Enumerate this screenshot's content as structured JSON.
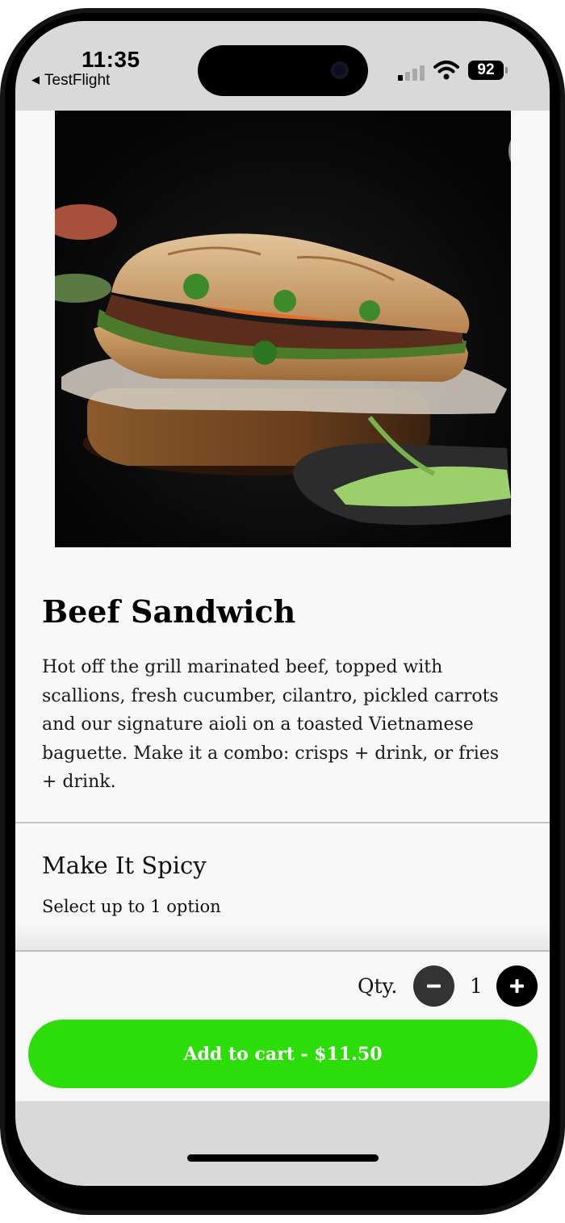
{
  "status_bar": {
    "time": "11:35",
    "back_app": "TestFlight",
    "battery": "92"
  },
  "product": {
    "name": "Beef Sandwich",
    "description": "Hot off the grill marinated beef, topped with scallions, fresh cucumber, cilantro, pickled carrots and our signature aioli on a toasted Vietnamese baguette. Make it a combo: crisps + drink, or fries + drink."
  },
  "options": {
    "title": "Make It Spicy",
    "subtitle": "Select up to 1 option"
  },
  "footer": {
    "qty_label": "Qty.",
    "qty_value": "1",
    "add_label": "Add to cart - $11.50"
  },
  "colors": {
    "accent": "#2ddd0a",
    "background": "#f8f8f8",
    "device_frame": "#141414"
  },
  "icons": [
    "back-triangle-icon",
    "signal-icon",
    "wifi-icon",
    "battery-icon",
    "close-icon",
    "minus-icon",
    "plus-icon"
  ]
}
